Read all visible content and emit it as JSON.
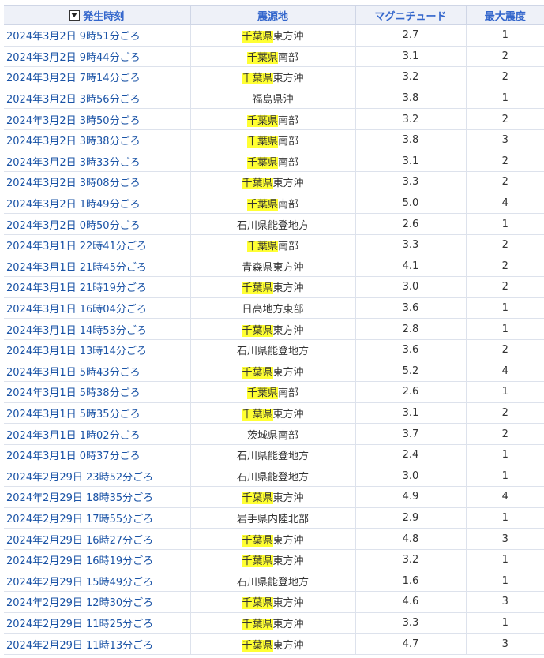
{
  "table": {
    "headers": {
      "time": "発生時刻",
      "epicenter": "震源地",
      "magnitude": "マグニチュード",
      "intensity": "最大震度"
    },
    "highlight": "千葉県",
    "rows": [
      {
        "time": "2024年3月2日 9時51分ごろ",
        "epicenter": "千葉県東方沖",
        "magnitude": "2.7",
        "intensity": "1"
      },
      {
        "time": "2024年3月2日 9時44分ごろ",
        "epicenter": "千葉県南部",
        "magnitude": "3.1",
        "intensity": "2"
      },
      {
        "time": "2024年3月2日 7時14分ごろ",
        "epicenter": "千葉県東方沖",
        "magnitude": "3.2",
        "intensity": "2"
      },
      {
        "time": "2024年3月2日 3時56分ごろ",
        "epicenter": "福島県沖",
        "magnitude": "3.8",
        "intensity": "1"
      },
      {
        "time": "2024年3月2日 3時50分ごろ",
        "epicenter": "千葉県南部",
        "magnitude": "3.2",
        "intensity": "2"
      },
      {
        "time": "2024年3月2日 3時38分ごろ",
        "epicenter": "千葉県南部",
        "magnitude": "3.8",
        "intensity": "3"
      },
      {
        "time": "2024年3月2日 3時33分ごろ",
        "epicenter": "千葉県南部",
        "magnitude": "3.1",
        "intensity": "2"
      },
      {
        "time": "2024年3月2日 3時08分ごろ",
        "epicenter": "千葉県東方沖",
        "magnitude": "3.3",
        "intensity": "2"
      },
      {
        "time": "2024年3月2日 1時49分ごろ",
        "epicenter": "千葉県南部",
        "magnitude": "5.0",
        "intensity": "4"
      },
      {
        "time": "2024年3月2日 0時50分ごろ",
        "epicenter": "石川県能登地方",
        "magnitude": "2.6",
        "intensity": "1"
      },
      {
        "time": "2024年3月1日 22時41分ごろ",
        "epicenter": "千葉県南部",
        "magnitude": "3.3",
        "intensity": "2"
      },
      {
        "time": "2024年3月1日 21時45分ごろ",
        "epicenter": "青森県東方沖",
        "magnitude": "4.1",
        "intensity": "2"
      },
      {
        "time": "2024年3月1日 21時19分ごろ",
        "epicenter": "千葉県東方沖",
        "magnitude": "3.0",
        "intensity": "2"
      },
      {
        "time": "2024年3月1日 16時04分ごろ",
        "epicenter": "日高地方東部",
        "magnitude": "3.6",
        "intensity": "1"
      },
      {
        "time": "2024年3月1日 14時53分ごろ",
        "epicenter": "千葉県東方沖",
        "magnitude": "2.8",
        "intensity": "1"
      },
      {
        "time": "2024年3月1日 13時14分ごろ",
        "epicenter": "石川県能登地方",
        "magnitude": "3.6",
        "intensity": "2"
      },
      {
        "time": "2024年3月1日 5時43分ごろ",
        "epicenter": "千葉県東方沖",
        "magnitude": "5.2",
        "intensity": "4"
      },
      {
        "time": "2024年3月1日 5時38分ごろ",
        "epicenter": "千葉県南部",
        "magnitude": "2.6",
        "intensity": "1"
      },
      {
        "time": "2024年3月1日 5時35分ごろ",
        "epicenter": "千葉県東方沖",
        "magnitude": "3.1",
        "intensity": "2"
      },
      {
        "time": "2024年3月1日 1時02分ごろ",
        "epicenter": "茨城県南部",
        "magnitude": "3.7",
        "intensity": "2"
      },
      {
        "time": "2024年3月1日 0時37分ごろ",
        "epicenter": "石川県能登地方",
        "magnitude": "2.4",
        "intensity": "1"
      },
      {
        "time": "2024年2月29日 23時52分ごろ",
        "epicenter": "石川県能登地方",
        "magnitude": "3.0",
        "intensity": "1"
      },
      {
        "time": "2024年2月29日 18時35分ごろ",
        "epicenter": "千葉県東方沖",
        "magnitude": "4.9",
        "intensity": "4"
      },
      {
        "time": "2024年2月29日 17時55分ごろ",
        "epicenter": "岩手県内陸北部",
        "magnitude": "2.9",
        "intensity": "1"
      },
      {
        "time": "2024年2月29日 16時27分ごろ",
        "epicenter": "千葉県東方沖",
        "magnitude": "4.8",
        "intensity": "3"
      },
      {
        "time": "2024年2月29日 16時19分ごろ",
        "epicenter": "千葉県東方沖",
        "magnitude": "3.2",
        "intensity": "1"
      },
      {
        "time": "2024年2月29日 15時49分ごろ",
        "epicenter": "石川県能登地方",
        "magnitude": "1.6",
        "intensity": "1"
      },
      {
        "time": "2024年2月29日 12時30分ごろ",
        "epicenter": "千葉県東方沖",
        "magnitude": "4.6",
        "intensity": "3"
      },
      {
        "time": "2024年2月29日 11時25分ごろ",
        "epicenter": "千葉県東方沖",
        "magnitude": "3.3",
        "intensity": "1"
      },
      {
        "time": "2024年2月29日 11時13分ごろ",
        "epicenter": "千葉県東方沖",
        "magnitude": "4.7",
        "intensity": "3"
      }
    ]
  },
  "colors": {
    "link": "#1a53a6",
    "header_text": "#3366cc",
    "header_bg": "#eef1f8",
    "highlight": "#ffff33"
  },
  "icons": {
    "sort": "sort-descending-icon"
  }
}
